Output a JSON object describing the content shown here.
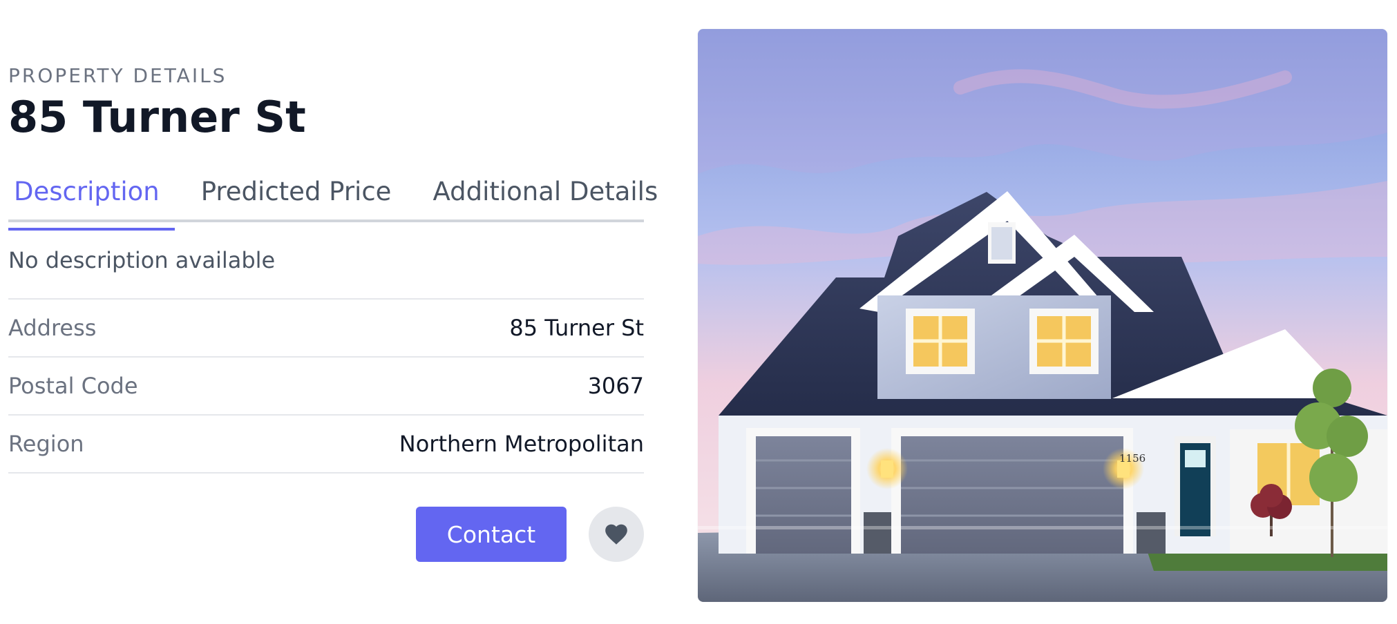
{
  "property": {
    "eyebrow": "PROPERTY DETAILS",
    "title": "85 Turner St"
  },
  "tabs": [
    {
      "label": "Description",
      "active": true
    },
    {
      "label": "Predicted Price",
      "active": false
    },
    {
      "label": "Additional Details",
      "active": false
    }
  ],
  "description": "No description available",
  "details": [
    {
      "label": "Address",
      "value": "85 Turner St"
    },
    {
      "label": "Postal Code",
      "value": "3067"
    },
    {
      "label": "Region",
      "value": "Northern Metropolitan"
    }
  ],
  "actions": {
    "contact_label": "Contact",
    "favorite_icon": "heart-icon"
  },
  "image": {
    "house_number": "1156"
  },
  "colors": {
    "accent": "#6366f1",
    "muted_text": "#6b7280",
    "border": "#e5e7eb",
    "favorite_background": "#e5e7eb",
    "heading": "#111827"
  }
}
